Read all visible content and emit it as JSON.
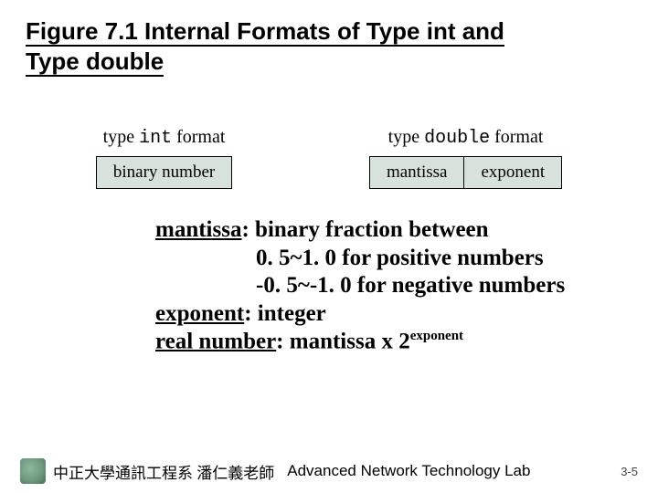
{
  "title": {
    "prefix": "Figure 7.1",
    "rest_line1": "  Internal Formats of Type int and",
    "line2": "Type double"
  },
  "formats": {
    "int": {
      "caption_prefix": "type ",
      "caption_mono": "int",
      "caption_suffix": " format",
      "cells": [
        "binary number"
      ]
    },
    "double": {
      "caption_prefix": "type ",
      "caption_mono": "double",
      "caption_suffix": " format",
      "cells": [
        "mantissa",
        "exponent"
      ]
    }
  },
  "definitions": {
    "mantissa_label": "mantissa",
    "mantissa_text": ": binary fraction between",
    "mantissa_range_pos": "0. 5~1. 0 for positive numbers",
    "mantissa_range_neg": "-0. 5~-1. 0 for negative numbers",
    "exponent_label": "exponent",
    "exponent_text": ": integer",
    "real_label": "real number",
    "real_text": ": mantissa x 2",
    "real_sup": "exponent"
  },
  "footer": {
    "cn": "中正大學通訊工程系 潘仁義老師",
    "en": "Advanced Network Technology Lab",
    "page": "3-5"
  }
}
